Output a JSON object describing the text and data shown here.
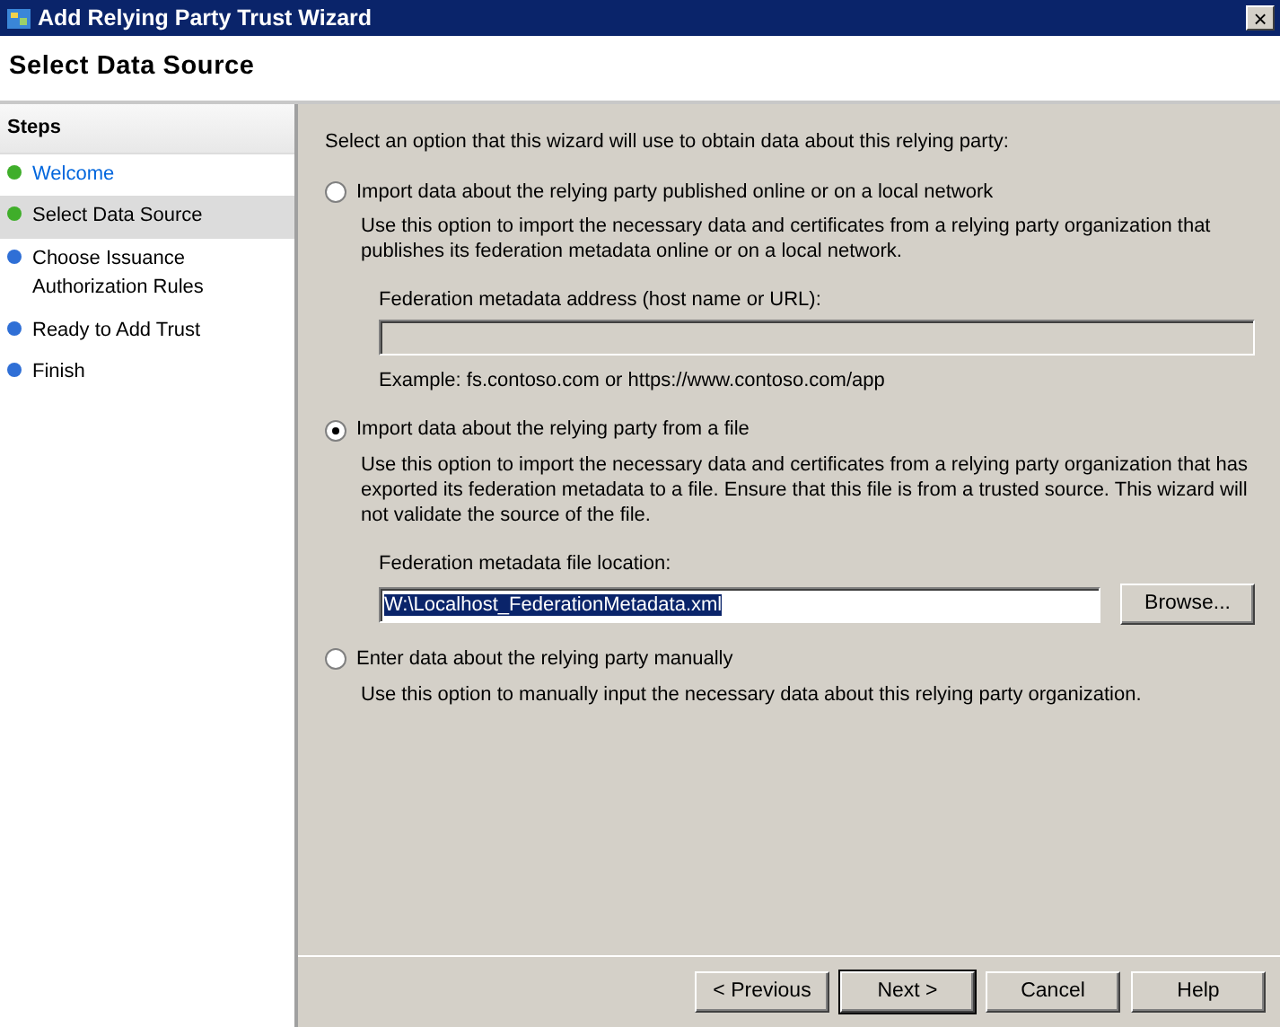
{
  "window": {
    "title": "Add Relying Party Trust Wizard",
    "close": "×"
  },
  "page_title": "Select Data Source",
  "steps": {
    "heading": "Steps",
    "items": [
      {
        "label": "Welcome",
        "color": "#3fae2a",
        "selected": false,
        "visited": true
      },
      {
        "label": "Select Data Source",
        "color": "#3fae2a",
        "selected": true,
        "visited": false
      },
      {
        "label": "Choose Issuance Authorization Rules",
        "color": "#2f6fd6",
        "selected": false,
        "visited": false
      },
      {
        "label": "Ready to Add Trust",
        "color": "#2f6fd6",
        "selected": false,
        "visited": false
      },
      {
        "label": "Finish",
        "color": "#2f6fd6",
        "selected": false,
        "visited": false
      }
    ]
  },
  "intro": "Select an option that this wizard will use to obtain data about this relying party:",
  "options": [
    {
      "label": "Import data about the relying party published online or on a local network",
      "selected": false,
      "description": "Use this option to import the necessary data and certificates from a relying party organization that publishes its federation metadata online or on a local network.",
      "field": {
        "label": "Federation metadata address (host name or URL):",
        "disabled": true,
        "example": "Example: fs.contoso.com or https://www.contoso.com/app"
      }
    },
    {
      "label": "Import data about the relying party from a file",
      "selected": true,
      "description": "Use this option to import the necessary data and certificates from a relying party organization that has exported its federation metadata to a file. Ensure that this file is from a trusted source.  This wizard will not validate the source of the file.",
      "field": {
        "label": "Federation metadata file location:",
        "disabled": false,
        "value": "W:\\Localhost_FederationMetadata.xml",
        "value_highlighted": true,
        "button": "Browse..."
      }
    },
    {
      "label": "Enter data about the relying party manually",
      "selected": false,
      "description": "Use this option to manually input the necessary data about this relying party organization."
    }
  ],
  "buttons": [
    {
      "label": "< Previous",
      "default": false
    },
    {
      "label": "Next >",
      "default": true
    },
    {
      "label": "Cancel",
      "default": false
    },
    {
      "label": "Help",
      "default": false
    }
  ]
}
